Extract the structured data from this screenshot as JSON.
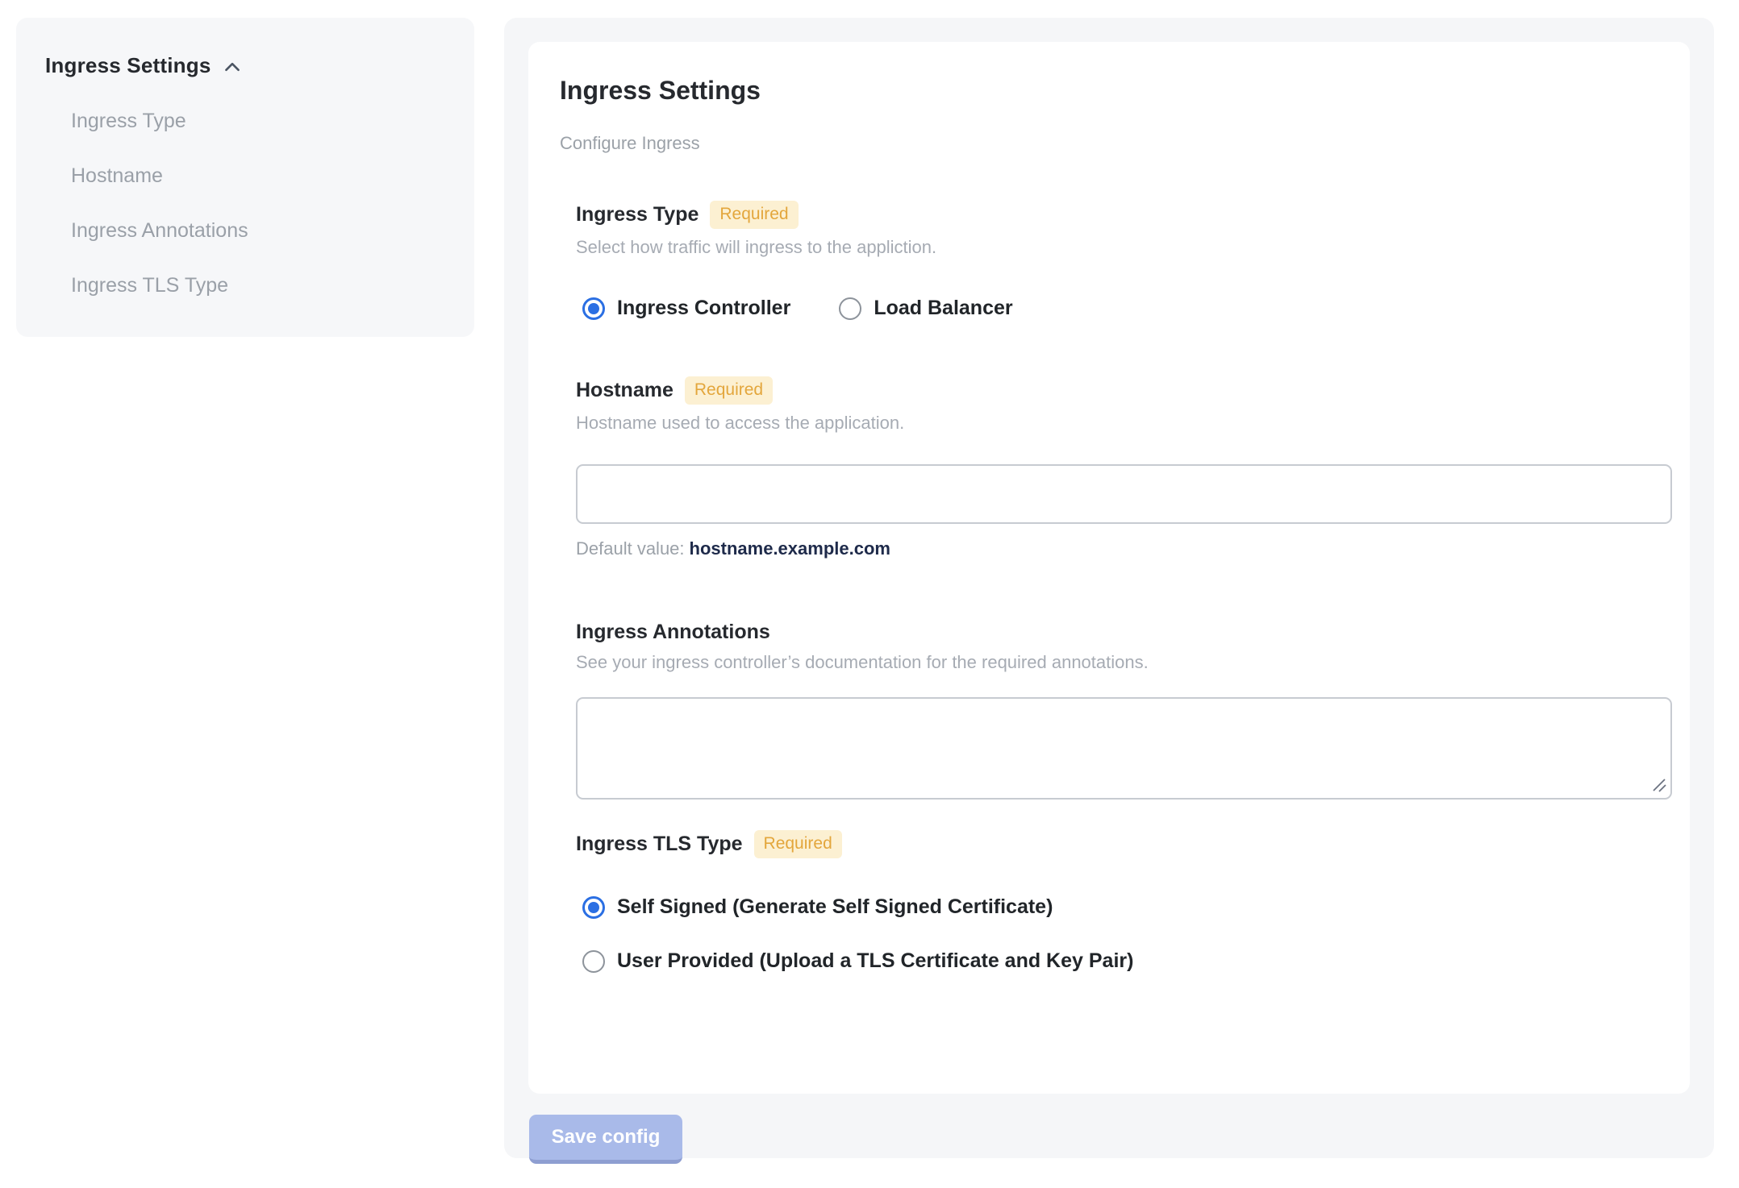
{
  "sidebar": {
    "header": "Ingress Settings",
    "items": [
      {
        "label": "Ingress Type"
      },
      {
        "label": "Hostname"
      },
      {
        "label": "Ingress Annotations"
      },
      {
        "label": "Ingress TLS Type"
      }
    ]
  },
  "main": {
    "title": "Ingress Settings",
    "subtitle": "Configure Ingress",
    "fields": {
      "ingress_type": {
        "label": "Ingress Type",
        "required_badge": "Required",
        "description": "Select how traffic will ingress to the appliction.",
        "options": [
          {
            "label": "Ingress Controller",
            "selected": true
          },
          {
            "label": "Load Balancer",
            "selected": false
          }
        ]
      },
      "hostname": {
        "label": "Hostname",
        "required_badge": "Required",
        "description": "Hostname used to access the application.",
        "value": "",
        "default_label": "Default value:",
        "default_value": "hostname.example.com"
      },
      "ingress_annotations": {
        "label": "Ingress Annotations",
        "description": "See your ingress controller’s documentation for the required annotations.",
        "value": ""
      },
      "ingress_tls_type": {
        "label": "Ingress TLS Type",
        "required_badge": "Required",
        "options": [
          {
            "label": "Self Signed (Generate Self Signed Certificate)",
            "selected": true
          },
          {
            "label": "User Provided (Upload a TLS Certificate and Key Pair)",
            "selected": false
          }
        ]
      }
    },
    "save_button_label": "Save config"
  },
  "colors": {
    "accent_blue": "#2b6fe3",
    "badge_text": "#e3a63c",
    "badge_bg": "#fcf0d2",
    "panel_bg": "#f5f6f8",
    "default_value_text": "#1e2a4a",
    "save_button_bg": "#a9bae9"
  }
}
